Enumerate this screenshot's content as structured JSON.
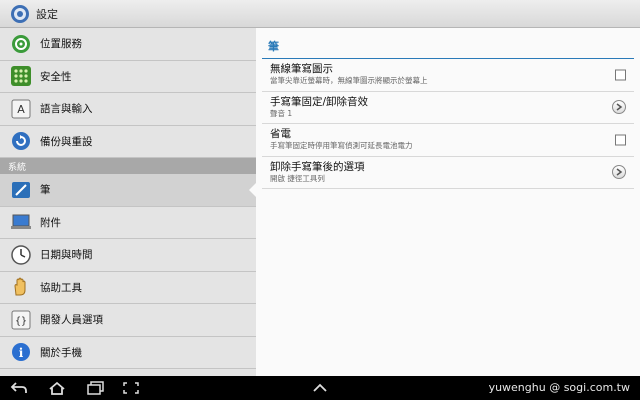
{
  "titlebar": {
    "title": "設定",
    "icon": "settings-icon"
  },
  "sidebar": {
    "items_top": [
      {
        "label": "位置服務",
        "icon": "location-icon"
      },
      {
        "label": "安全性",
        "icon": "security-grid-icon"
      },
      {
        "label": "語言與輸入",
        "icon": "language-icon"
      },
      {
        "label": "備份與重設",
        "icon": "backup-icon"
      }
    ],
    "section_header": "系統",
    "items_system": [
      {
        "label": "筆",
        "icon": "pen-icon",
        "selected": true
      },
      {
        "label": "附件",
        "icon": "accessory-icon"
      },
      {
        "label": "日期與時間",
        "icon": "clock-icon"
      },
      {
        "label": "協助工具",
        "icon": "hand-icon"
      },
      {
        "label": "開發人員選項",
        "icon": "developer-braces-icon"
      },
      {
        "label": "關於手機",
        "icon": "info-icon"
      }
    ]
  },
  "content": {
    "section_title": "筆",
    "prefs": [
      {
        "title": "無線筆寫圖示",
        "subtitle": "當筆尖靠近螢幕時，無線筆圖示將顯示於螢幕上",
        "control": "checkbox",
        "checked": false
      },
      {
        "title": "手寫筆固定/卸除音效",
        "subtitle": "聲音 1",
        "control": "chevron"
      },
      {
        "title": "省電",
        "subtitle": "手寫筆固定時停用筆寫偵測可延長電池電力",
        "control": "checkbox",
        "checked": false
      },
      {
        "title": "卸除手寫筆後的選項",
        "subtitle": "開啟 捷徑工具列",
        "control": "chevron"
      }
    ]
  },
  "navbar": {
    "buttons": [
      "back-icon",
      "home-icon",
      "recent-apps-icon",
      "screenshot-icon",
      "up-arrow-icon"
    ],
    "watermark": "yuwenghu @ sogi.com.tw"
  },
  "colors": {
    "accent": "#2a7ab8",
    "sidebar_bg": "#e4e4e4",
    "content_bg": "#fafafa",
    "section_header_bg": "#a8a8a8"
  }
}
